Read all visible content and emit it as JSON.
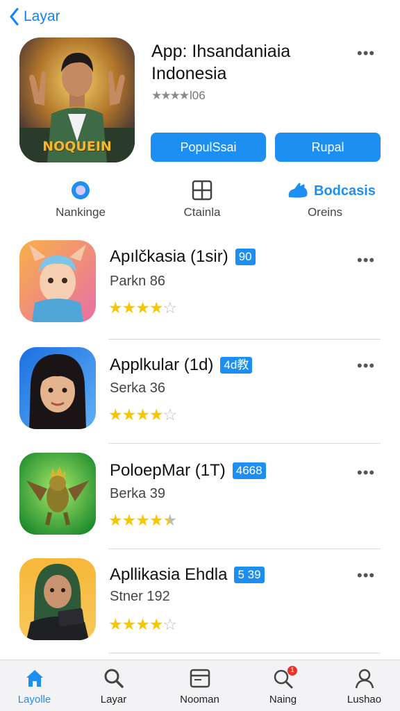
{
  "nav": {
    "back_label": "Layar"
  },
  "hero": {
    "title": "App: Ihsandaniaia Indonesia",
    "rating_text": "l06",
    "stars": "★★★★",
    "icon_caption": "NOQUEIN",
    "button_left": "PopulSsai",
    "button_right": "Rupal"
  },
  "categories": [
    {
      "label": "Nankinge",
      "icon": "circle-icon"
    },
    {
      "label": "Ctainla",
      "icon": "grid-icon"
    },
    {
      "label": "Oreins",
      "icon": "rabbit-icon",
      "title": "Bodcasis"
    }
  ],
  "apps": [
    {
      "name": "Apılčkasia  (1sir)",
      "badge": "90",
      "sub": "Parkn  86",
      "rating": 4
    },
    {
      "name": "Applkular  (1d)",
      "badge": "4d教",
      "sub": "Serka  36",
      "rating": 4
    },
    {
      "name": "PoloepMar  (1T)",
      "badge": "4668",
      "sub": "Berka  39",
      "rating": 4.5
    },
    {
      "name": "Apllikasia Ehdla",
      "badge": "5 39",
      "sub": "Stner  192",
      "rating": 4
    }
  ],
  "tabs": [
    {
      "label": "Layolle",
      "icon": "home-icon"
    },
    {
      "label": "Layar",
      "icon": "search-icon"
    },
    {
      "label": "Nooman",
      "icon": "window-icon"
    },
    {
      "label": "Naing",
      "icon": "search-badge-icon",
      "badge": "1"
    },
    {
      "label": "Lushao",
      "icon": "person-icon"
    }
  ],
  "colors": {
    "accent": "#1d8ff2",
    "star": "#f6c700",
    "back": "#0a84ff"
  }
}
